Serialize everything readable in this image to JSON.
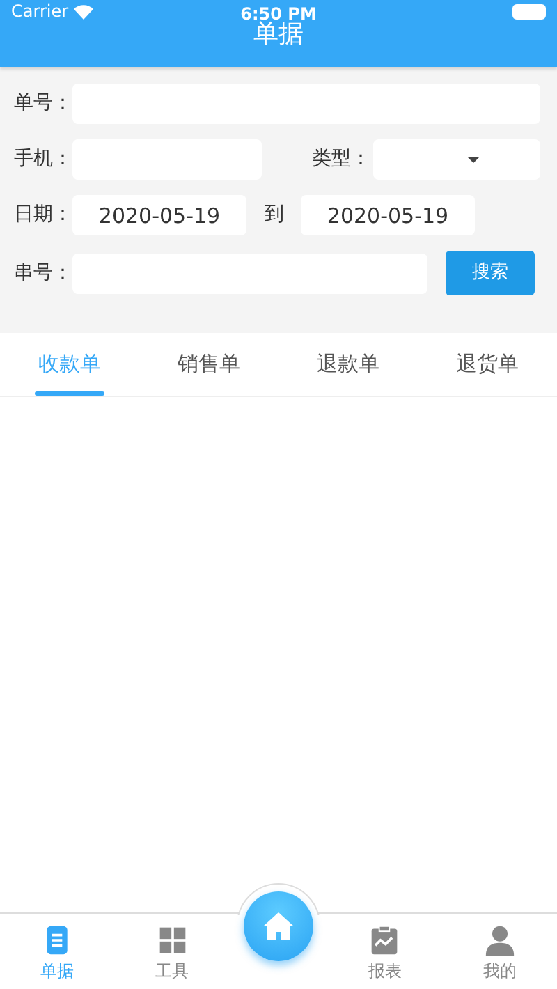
{
  "status_bar": {
    "carrier": "Carrier",
    "time": "6:50 PM"
  },
  "header": {
    "title": "单据"
  },
  "form": {
    "order_no": {
      "label": "单号："
    },
    "phone": {
      "label": "手机："
    },
    "type": {
      "label": "类型："
    },
    "date": {
      "label": "日期：",
      "from": "2020-05-19",
      "separator": "到",
      "to": "2020-05-19"
    },
    "serial_no": {
      "label": "串号："
    },
    "search_button": "搜索"
  },
  "tabs": [
    {
      "label": "收款单",
      "selected": true
    },
    {
      "label": "销售单",
      "selected": false
    },
    {
      "label": "退款单",
      "selected": false
    },
    {
      "label": "退货单",
      "selected": false
    }
  ],
  "bottom_nav": [
    {
      "kind": "doc",
      "label": "单据",
      "selected": true
    },
    {
      "kind": "grid",
      "label": "工具",
      "selected": false
    },
    {
      "kind": "home"
    },
    {
      "kind": "report",
      "label": "报表",
      "selected": false
    },
    {
      "kind": "user",
      "label": "我的",
      "selected": false
    }
  ]
}
